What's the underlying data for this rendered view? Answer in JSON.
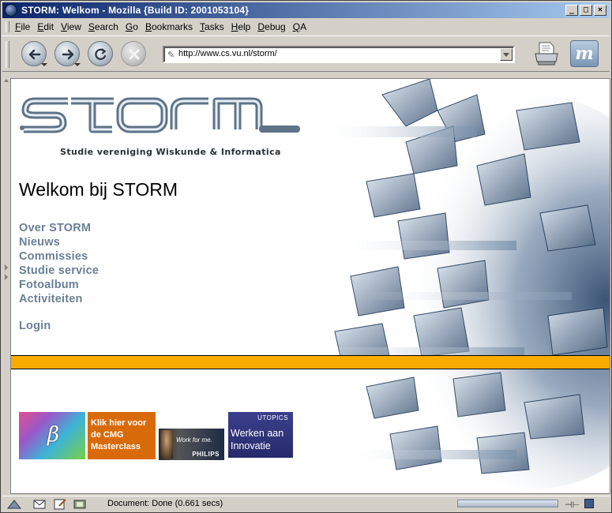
{
  "window": {
    "title": "STORM: Welkom - Mozilla {Build ID: 2001053104}",
    "controls": [
      "_",
      "□",
      "×"
    ]
  },
  "menubar": {
    "items": [
      "File",
      "Edit",
      "View",
      "Search",
      "Go",
      "Bookmarks",
      "Tasks",
      "Help",
      "Debug",
      "QA"
    ]
  },
  "navbar": {
    "back_icon": "back-arrow-icon",
    "forward_icon": "forward-arrow-icon",
    "reload_icon": "reload-icon",
    "stop_icon": "stop-icon",
    "url": "http://www.cs.vu.nl/storm/",
    "brand_glyph": "m"
  },
  "page": {
    "subtitle": "Studie vereniging Wiskunde & Informatica",
    "heading": "Welkom bij STORM",
    "nav": [
      "Over STORM",
      "Nieuws",
      "Commissies",
      "Studie service",
      "Fotoalbum",
      "Activiteiten"
    ],
    "login": "Login",
    "banners": {
      "beta": "β",
      "cmg": "Klik hier voor de CMG Masterclass",
      "philips_tagline": "Work for me.",
      "philips_brand": "PHILIPS",
      "utopics_brand": "UTOPICS",
      "utopics_text": "Werken aan Innovatie"
    },
    "colors": {
      "accent_bar": "#f9ac00",
      "nav_link": "#6a7f96",
      "logo": "#5e7388"
    }
  },
  "statusbar": {
    "text": "Document: Done (0.661 secs)"
  }
}
